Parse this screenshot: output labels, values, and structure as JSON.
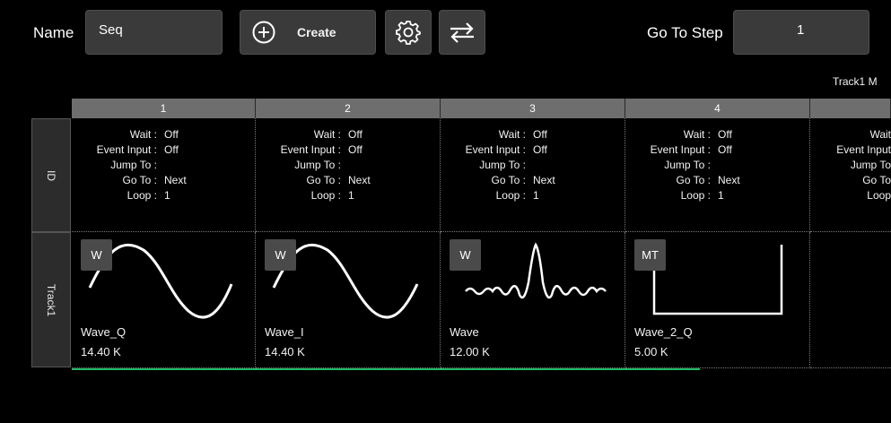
{
  "toolbar": {
    "name_label": "Name",
    "name_value": "Seq",
    "create_label": "Create",
    "goto_label": "Go To Step",
    "goto_value": "1"
  },
  "track_tag": "Track1  M",
  "row_labels": {
    "id": "ID",
    "track": "Track1"
  },
  "columns": [
    "1",
    "2",
    "3",
    "4",
    ""
  ],
  "field_labels": {
    "wait": "Wait :",
    "event_input": "Event Input :",
    "jump_to": "Jump To :",
    "go_to": "Go To :",
    "loop": "Loop :"
  },
  "steps": [
    {
      "wait": "Off",
      "event_input": "Off",
      "jump_to": "",
      "go_to": "Next",
      "loop": "1",
      "badge": "W",
      "wave_name": "Wave_Q",
      "wave_value": "14.40 K"
    },
    {
      "wait": "Off",
      "event_input": "Off",
      "jump_to": "",
      "go_to": "Next",
      "loop": "1",
      "badge": "W",
      "wave_name": "Wave_I",
      "wave_value": "14.40 K"
    },
    {
      "wait": "Off",
      "event_input": "Off",
      "jump_to": "",
      "go_to": "Next",
      "loop": "1",
      "badge": "W",
      "wave_name": "Wave",
      "wave_value": "12.00 K"
    },
    {
      "wait": "Off",
      "event_input": "Off",
      "jump_to": "",
      "go_to": "Next",
      "loop": "1",
      "badge": "MT",
      "wave_name": "Wave_2_Q",
      "wave_value": "5.00 K"
    },
    {
      "wait": "Wait",
      "event_input": "Event Input",
      "jump_to": "Jump To",
      "go_to": "Go To",
      "loop": "Loop"
    }
  ],
  "icons": {
    "create": "plus-circle-icon",
    "settings": "gear-icon",
    "swap": "swap-arrows-icon"
  },
  "colors": {
    "background": "#000000",
    "header": "#6e6e6e",
    "control": "#3a3a3a",
    "progress": "#1fb864"
  }
}
